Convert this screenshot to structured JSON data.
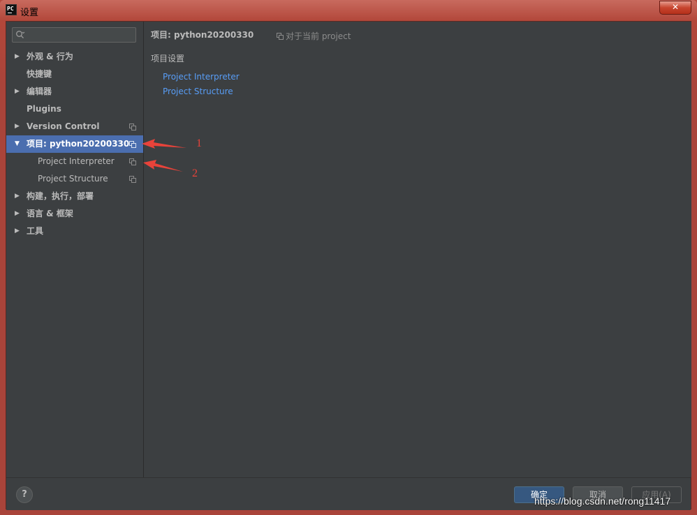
{
  "window": {
    "title": "设置",
    "close_label": "✕"
  },
  "search": {
    "placeholder": ""
  },
  "sidebar": {
    "items": [
      {
        "label": "外观 & 行为",
        "expandable": true
      },
      {
        "label": "快捷键",
        "expandable": false
      },
      {
        "label": "编辑器",
        "expandable": true
      },
      {
        "label": "Plugins",
        "expandable": false
      },
      {
        "label": "Version Control",
        "expandable": true
      },
      {
        "label": "项目: python20200330",
        "expandable": true,
        "expanded": true,
        "selected": true
      },
      {
        "label": "Project Interpreter",
        "child": true
      },
      {
        "label": "Project Structure",
        "child": true
      },
      {
        "label": "构建，执行，部署",
        "expandable": true
      },
      {
        "label": "语言 & 框架",
        "expandable": true
      },
      {
        "label": "工具",
        "expandable": true
      }
    ]
  },
  "content": {
    "title": "项目: python20200330",
    "scope_note": "对于当前 project",
    "section_label": "项目设置",
    "links": [
      "Project Interpreter",
      "Project Structure"
    ]
  },
  "footer": {
    "help_label": "?",
    "ok_label": "确定",
    "cancel_label": "取消",
    "apply_label": "应用(A)"
  },
  "annotations": {
    "arrow1_label": "1",
    "arrow2_label": "2"
  },
  "watermark": "https://blog.csdn.net/rong11417",
  "colors": {
    "selection": "#4b6eaf",
    "link": "#589df6",
    "background": "#3c3f41",
    "annotation": "#e8433a"
  }
}
